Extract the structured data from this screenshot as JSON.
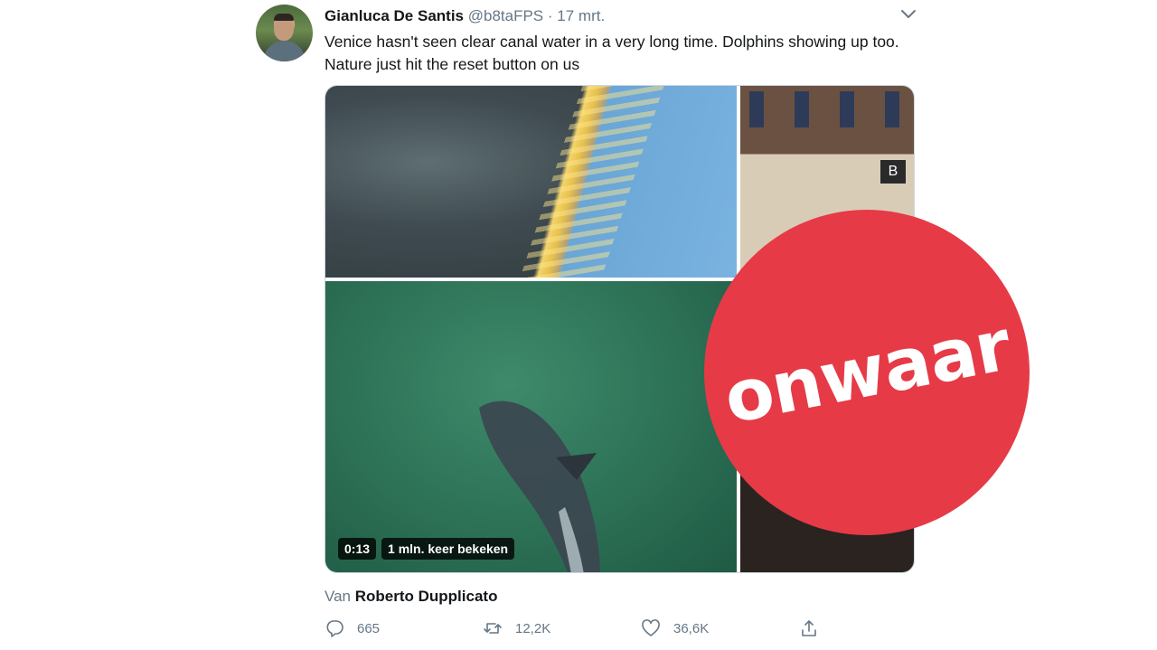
{
  "tweet": {
    "author_name": "Gianluca De Santis",
    "handle": "@b8taFPS",
    "separator": "·",
    "date": "17 mrt.",
    "text": "Venice hasn't seen clear canal water in a very long time. Dolphins showing up too. Nature just hit the reset button on us",
    "video": {
      "duration": "0:13",
      "views": "1 mln. keer bekeken"
    },
    "attribution_prefix": "Van",
    "attribution_name": "Roberto Dupplicato",
    "actions": {
      "replies": "665",
      "retweets": "12,2K",
      "likes": "36,6K"
    }
  },
  "verdict_stamp": {
    "label": "onwaar",
    "color": "#e63a47"
  },
  "icons": [
    "chevron-down-icon",
    "reply-icon",
    "retweet-icon",
    "like-icon",
    "share-icon"
  ],
  "colors": {
    "text": "#14171a",
    "secondary": "#657786"
  }
}
